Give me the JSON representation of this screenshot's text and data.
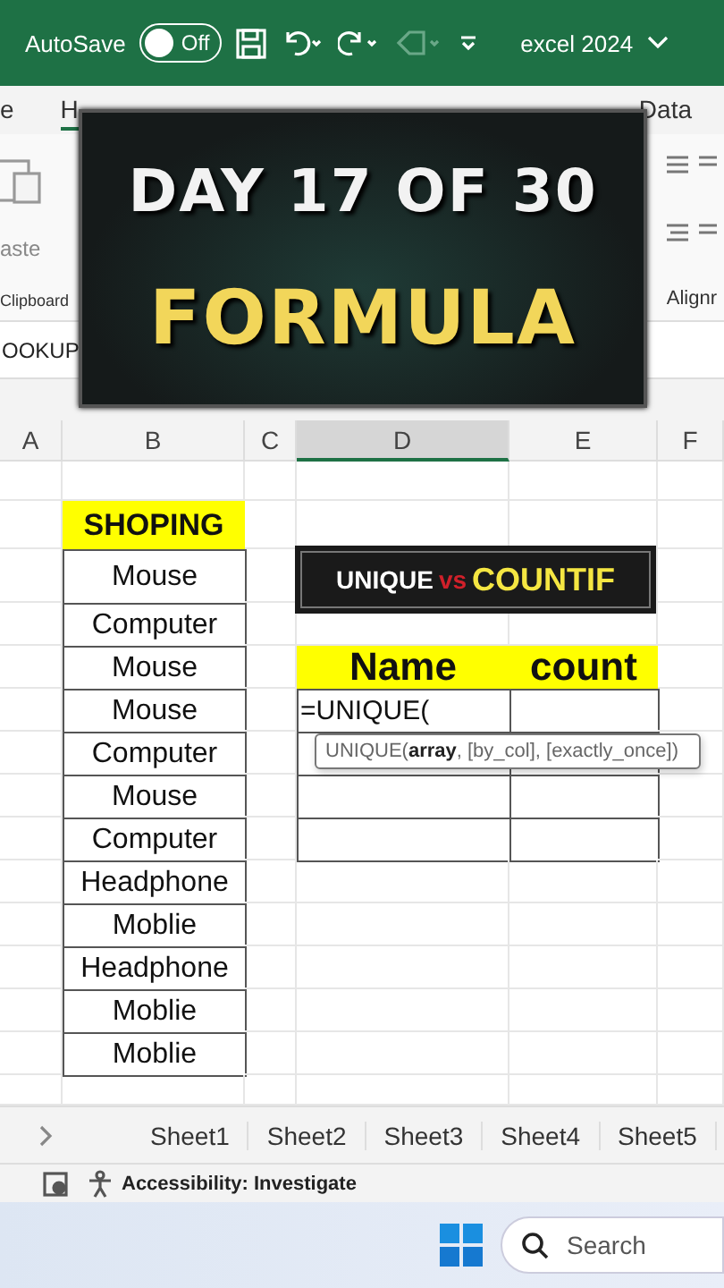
{
  "title_bar": {
    "autosave_label": "AutoSave",
    "autosave_toggle": {
      "label": "Off",
      "on": false
    },
    "file_name": "excel 2024"
  },
  "ribbon_tabs": [
    {
      "label": "e",
      "selected": false
    },
    {
      "label": "H",
      "selected": true
    },
    {
      "label": "Data",
      "selected": false
    }
  ],
  "ribbon": {
    "paste_label": "aste",
    "groups": [
      "Clipboard",
      "Alignr"
    ]
  },
  "name_box": "OOKUP",
  "overlay_card": {
    "line_1": "DAY 17 OF 30",
    "line_2": "FORMULA"
  },
  "columns": [
    {
      "label": "A",
      "selected": false
    },
    {
      "label": "B",
      "selected": false
    },
    {
      "label": "C",
      "selected": false
    },
    {
      "label": "D",
      "selected": true
    },
    {
      "label": "E",
      "selected": false
    },
    {
      "label": "F",
      "selected": false
    }
  ],
  "rows": [
    {},
    {
      "B": {
        "kind": "header",
        "text": "SHOPING"
      }
    },
    {
      "B": {
        "kind": "item",
        "text": "Mouse"
      }
    },
    {
      "B": {
        "kind": "item",
        "text": "Computer"
      }
    },
    {
      "B": {
        "kind": "item",
        "text": "Mouse"
      },
      "D": {
        "kind": "header",
        "text": "Name"
      },
      "E": {
        "kind": "header",
        "text": "count"
      }
    },
    {
      "B": {
        "kind": "item",
        "text": "Mouse"
      },
      "D": {
        "kind": "input",
        "text": "=UNIQUE("
      },
      "E": {
        "kind": "item"
      }
    },
    {
      "B": {
        "kind": "item",
        "text": "Computer"
      },
      "D": {
        "kind": "item"
      },
      "E": {
        "kind": "item"
      }
    },
    {
      "B": {
        "kind": "item",
        "text": "Mouse"
      },
      "D": {
        "kind": "item"
      },
      "E": {
        "kind": "item"
      }
    },
    {
      "B": {
        "kind": "item",
        "text": "Computer"
      },
      "D": {
        "kind": "item"
      },
      "E": {
        "kind": "item"
      }
    },
    {
      "B": {
        "kind": "item",
        "text": "Headphone"
      }
    },
    {
      "B": {
        "kind": "item",
        "text": "Moblie"
      }
    },
    {
      "B": {
        "kind": "item",
        "text": "Headphone"
      }
    },
    {
      "B": {
        "kind": "item",
        "text": "Moblie"
      }
    },
    {
      "B": {
        "kind": "item",
        "text": "Moblie"
      }
    },
    {}
  ],
  "banner": {
    "left": "UNIQUE",
    "middle": "vs",
    "right": "COUNTIF"
  },
  "tooltip": "UNIQUE(**array**, [by_col], [exactly_once])",
  "sheet_tabs": [
    "Sheet1",
    "Sheet2",
    "Sheet3",
    "Sheet4",
    "Sheet5"
  ],
  "status_bar": {
    "accessibility": "Accessibility: Investigate"
  },
  "taskbar": {
    "search_placeholder": "Search"
  }
}
